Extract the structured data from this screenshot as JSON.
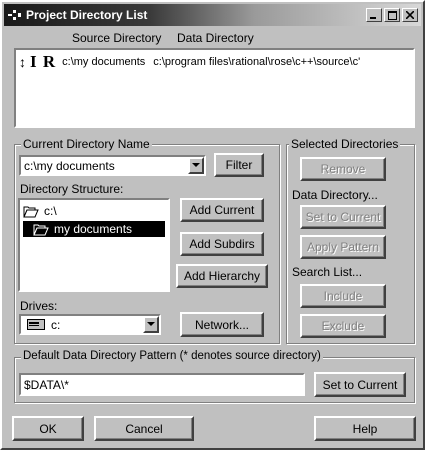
{
  "window": {
    "title": "Project Directory List"
  },
  "columns": {
    "source": "Source Directory",
    "data": "Data Directory"
  },
  "list": {
    "rows": [
      {
        "flags": "↕",
        "flag_big": "I R",
        "source": "c:\\my documents",
        "data": "c:\\program files\\rational\\rose\\c++\\source\\c'"
      }
    ]
  },
  "current_dir": {
    "group_title": "Current Directory Name",
    "value": "c:\\my documents",
    "filter_label": "Filter",
    "structure_label": "Directory Structure:",
    "tree": [
      {
        "label": "c:\\",
        "selected": false
      },
      {
        "label": "my documents",
        "selected": true
      }
    ],
    "add_current_label": "Add Current",
    "add_subdirs_label": "Add Subdirs",
    "add_hierarchy_label": "Add Hierarchy",
    "drives_label": "Drives:",
    "drive_value": "c:",
    "network_label": "Network..."
  },
  "selected_dirs": {
    "group_title": "Selected Directories",
    "remove_label": "Remove",
    "data_dir_label": "Data Directory...",
    "set_to_current_label": "Set to Current",
    "apply_pattern_label": "Apply Pattern",
    "search_list_label": "Search List...",
    "include_label": "Include",
    "exclude_label": "Exclude"
  },
  "pattern": {
    "group_title": "Default Data Directory Pattern  (* denotes source directory)",
    "value": "$DATA\\*",
    "set_to_current_label": "Set to Current"
  },
  "footer": {
    "ok_label": "OK",
    "cancel_label": "Cancel",
    "help_label": "Help"
  }
}
